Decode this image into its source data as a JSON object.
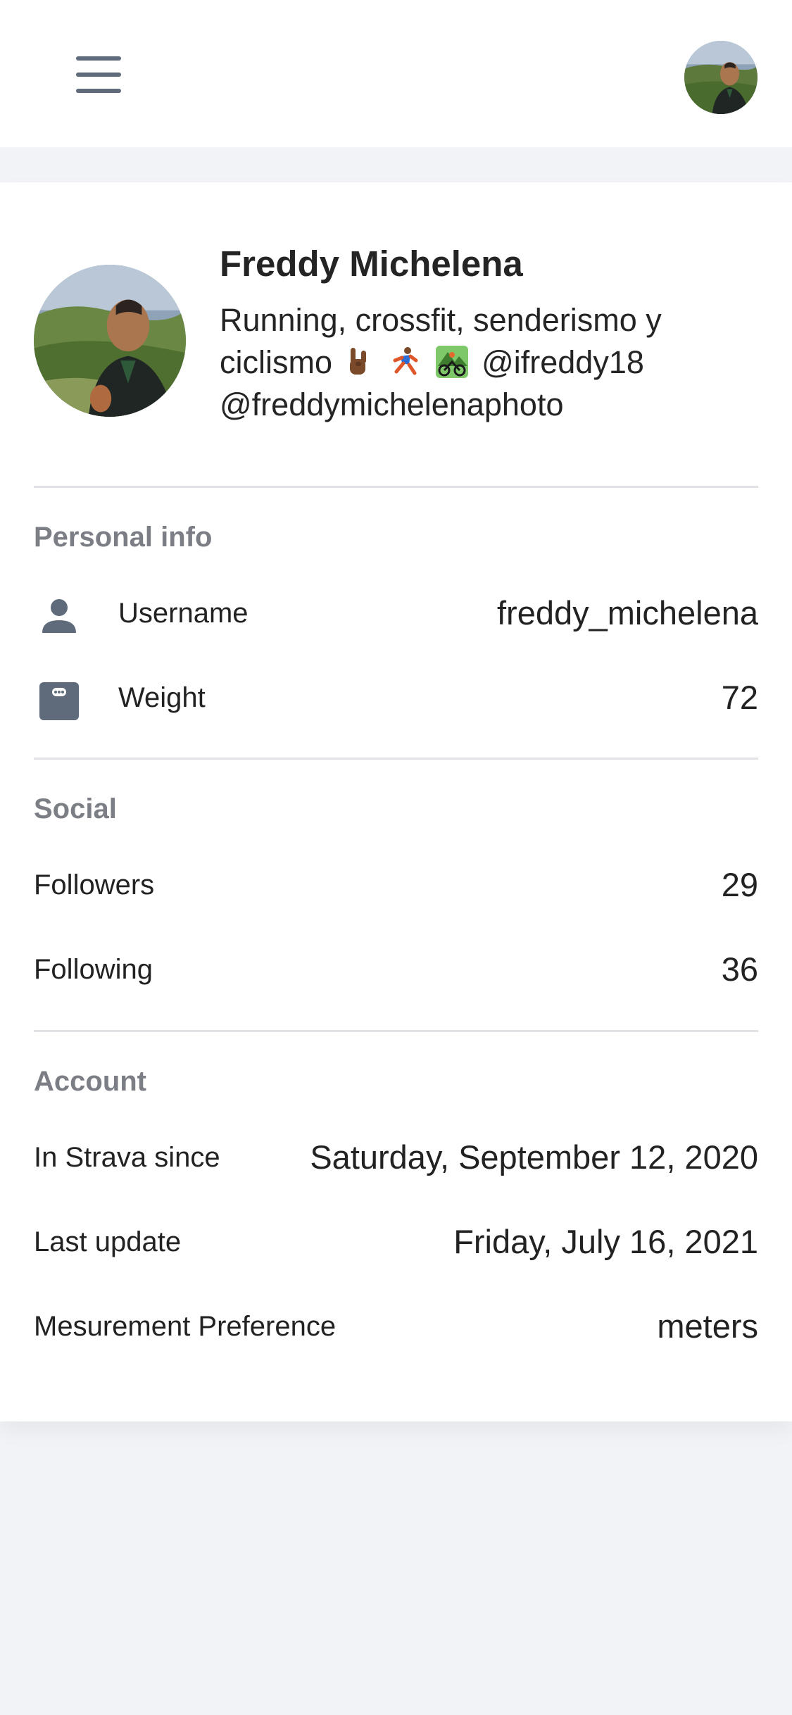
{
  "header": {
    "menu_icon": "hamburger-menu-icon",
    "avatar_icon": "user-avatar"
  },
  "profile": {
    "name": "Freddy Michelena",
    "bio_line1": "Running, crossfit, senderismo y",
    "bio_line2_text": "ciclismo",
    "bio_emojis": [
      "sign-of-horns-emoji",
      "person-running-emoji",
      "mountain-biking-emoji"
    ],
    "bio_line2_handle": "@ifreddy18",
    "bio_line3": "@freddymichelenaphoto"
  },
  "sections": {
    "personal": {
      "title": "Personal info",
      "username_label": "Username",
      "username_value": "freddy_michelena",
      "username_icon": "person-icon",
      "weight_label": "Weight",
      "weight_value": "72",
      "weight_icon": "scale-icon"
    },
    "social": {
      "title": "Social",
      "followers_label": "Followers",
      "followers_value": "29",
      "following_label": "Following",
      "following_value": "36"
    },
    "account": {
      "title": "Account",
      "since_label": "In Strava since",
      "since_value": "Saturday, September 12, 2020",
      "update_label": "Last update",
      "update_value": "Friday, July 16, 2021",
      "pref_label": "Mesurement Preference",
      "pref_value": "meters"
    }
  },
  "colors": {
    "page_bg": "#f2f3f7",
    "card_bg": "#ffffff",
    "icon_gray": "#5f6b7a",
    "section_label": "#7b7e84",
    "divider": "#e1e2e6"
  }
}
